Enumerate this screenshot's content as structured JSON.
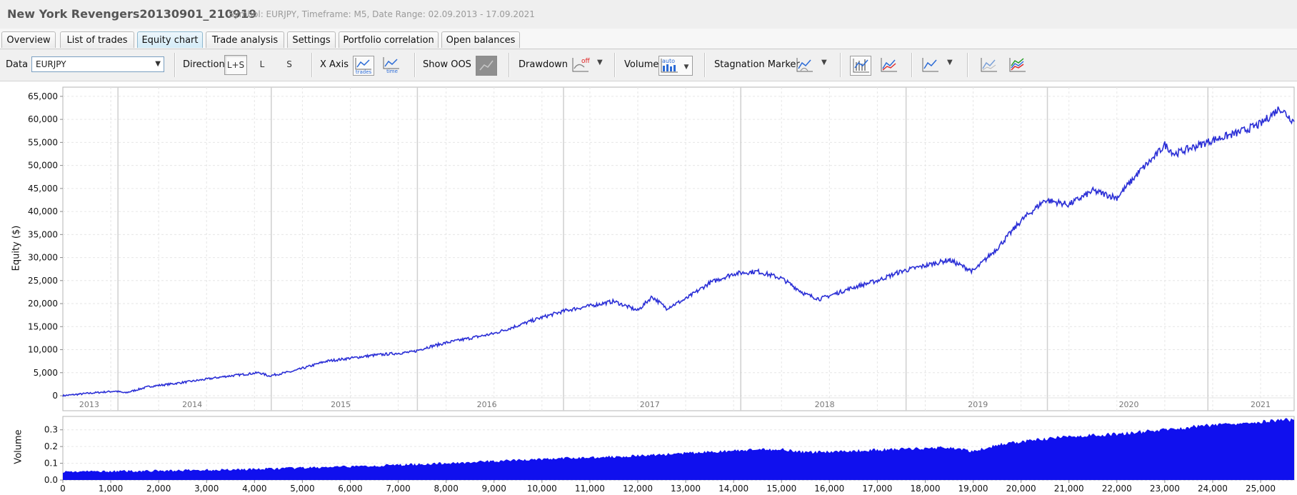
{
  "window": {
    "title": "New York Revengers20130901_210919",
    "subtitle": "Symbol: EURJPY, Timeframe: M5, Date Range: 02.09.2013 - 17.09.2021"
  },
  "tabs": [
    {
      "label": "Overview",
      "active": false
    },
    {
      "label": "List of trades",
      "active": false
    },
    {
      "label": "Equity chart",
      "active": true
    },
    {
      "label": "Trade analysis",
      "active": false
    },
    {
      "label": "Settings",
      "active": false
    },
    {
      "label": "Portfolio correlation",
      "active": false
    },
    {
      "label": "Open balances",
      "active": false
    }
  ],
  "toolbar": {
    "data_label": "Data",
    "data_value": "EURJPY",
    "direction_label": "Direction",
    "direction_ls": "L+S",
    "direction_l": "L",
    "direction_s": "S",
    "xaxis_label": "X Axis",
    "xaxis_trades": "trades",
    "xaxis_time": "time",
    "show_oos_label": "Show OOS",
    "drawdown_label": "Drawdown",
    "drawdown_state": "off",
    "volume_label": "Volume",
    "volume_state": "auto",
    "stagnation_label": "Stagnation Marker",
    "icons": [
      "chart-trades-icon",
      "chart-time-icon",
      "show-oos-icon",
      "drawdown-icon",
      "volume-icon",
      "stagnation-marker-icon",
      "bars-chart-icon",
      "line-red-icon",
      "line-blue-icon",
      "line-faded-icon",
      "multi-line-icon"
    ]
  },
  "colors": {
    "equity_line": "#2b2fd6",
    "volume_fill": "#1010ee",
    "grid": "#e6e6e6"
  },
  "chart_data": [
    {
      "type": "line",
      "ylabel": "Equity ($)",
      "ylim": [
        0,
        67000
      ],
      "y_ticks": [
        "0",
        "5,000",
        "10,000",
        "15,000",
        "20,000",
        "25,000",
        "30,000",
        "35,000",
        "40,000",
        "45,000",
        "50,000",
        "55,000",
        "60,000",
        "65,000"
      ],
      "x_year_labels": [
        "2013",
        "2014",
        "2015",
        "2016",
        "2017",
        "2018",
        "2019",
        "2020",
        "2021"
      ],
      "grid": true,
      "series": [
        {
          "x": [
            0,
            500,
            1100,
            1300,
            1800,
            2300,
            2800,
            3400,
            4100,
            4300,
            4800,
            5500,
            6500,
            7300,
            7600,
            8000,
            9000,
            10000,
            10500,
            11500,
            12000,
            12300,
            12600,
            13000,
            13500,
            14000,
            14500,
            15000,
            15500,
            15800,
            16500,
            17000,
            17500,
            18500,
            19000,
            19500,
            20000,
            20500,
            21000,
            21500,
            22000,
            22500,
            22800,
            23000,
            23200,
            24000,
            24500,
            25000,
            25400,
            25700
          ],
          "values": [
            0,
            500,
            1000,
            600,
            2000,
            2600,
            3300,
            4200,
            5000,
            4300,
            5300,
            7500,
            8800,
            9500,
            10500,
            11500,
            13500,
            17000,
            18500,
            20500,
            18500,
            21500,
            19000,
            21000,
            24500,
            26500,
            27000,
            25500,
            22000,
            21000,
            23500,
            25000,
            27000,
            29500,
            27000,
            32000,
            38000,
            42500,
            41500,
            44500,
            43000,
            49000,
            52000,
            54500,
            52500,
            55500,
            57000,
            59000,
            62500,
            59500
          ]
        }
      ]
    },
    {
      "type": "area",
      "ylabel": "Volume",
      "ylim": [
        0,
        0.38
      ],
      "y_ticks": [
        "0.0",
        "0.1",
        "0.2",
        "0.3"
      ],
      "x_ticks": [
        "0",
        "1,000",
        "2,000",
        "3,000",
        "4,000",
        "5,000",
        "6,000",
        "7,000",
        "8,000",
        "9,000",
        "10,000",
        "11,000",
        "12,000",
        "13,000",
        "14,000",
        "15,000",
        "16,000",
        "17,000",
        "18,000",
        "19,000",
        "20,000",
        "21,000",
        "22,000",
        "23,000",
        "24,000",
        "25,000"
      ],
      "xlim": [
        0,
        25700
      ],
      "series": [
        {
          "x": [
            0,
            2000,
            4000,
            6000,
            8000,
            10000,
            12000,
            13000,
            14000,
            15000,
            15500,
            17000,
            18500,
            19000,
            19500,
            20000,
            21000,
            22000,
            23000,
            24000,
            25000,
            25700
          ],
          "values": [
            0.05,
            0.055,
            0.065,
            0.08,
            0.1,
            0.125,
            0.145,
            0.16,
            0.175,
            0.185,
            0.165,
            0.18,
            0.195,
            0.17,
            0.21,
            0.23,
            0.26,
            0.275,
            0.3,
            0.33,
            0.35,
            0.36
          ]
        }
      ]
    }
  ]
}
